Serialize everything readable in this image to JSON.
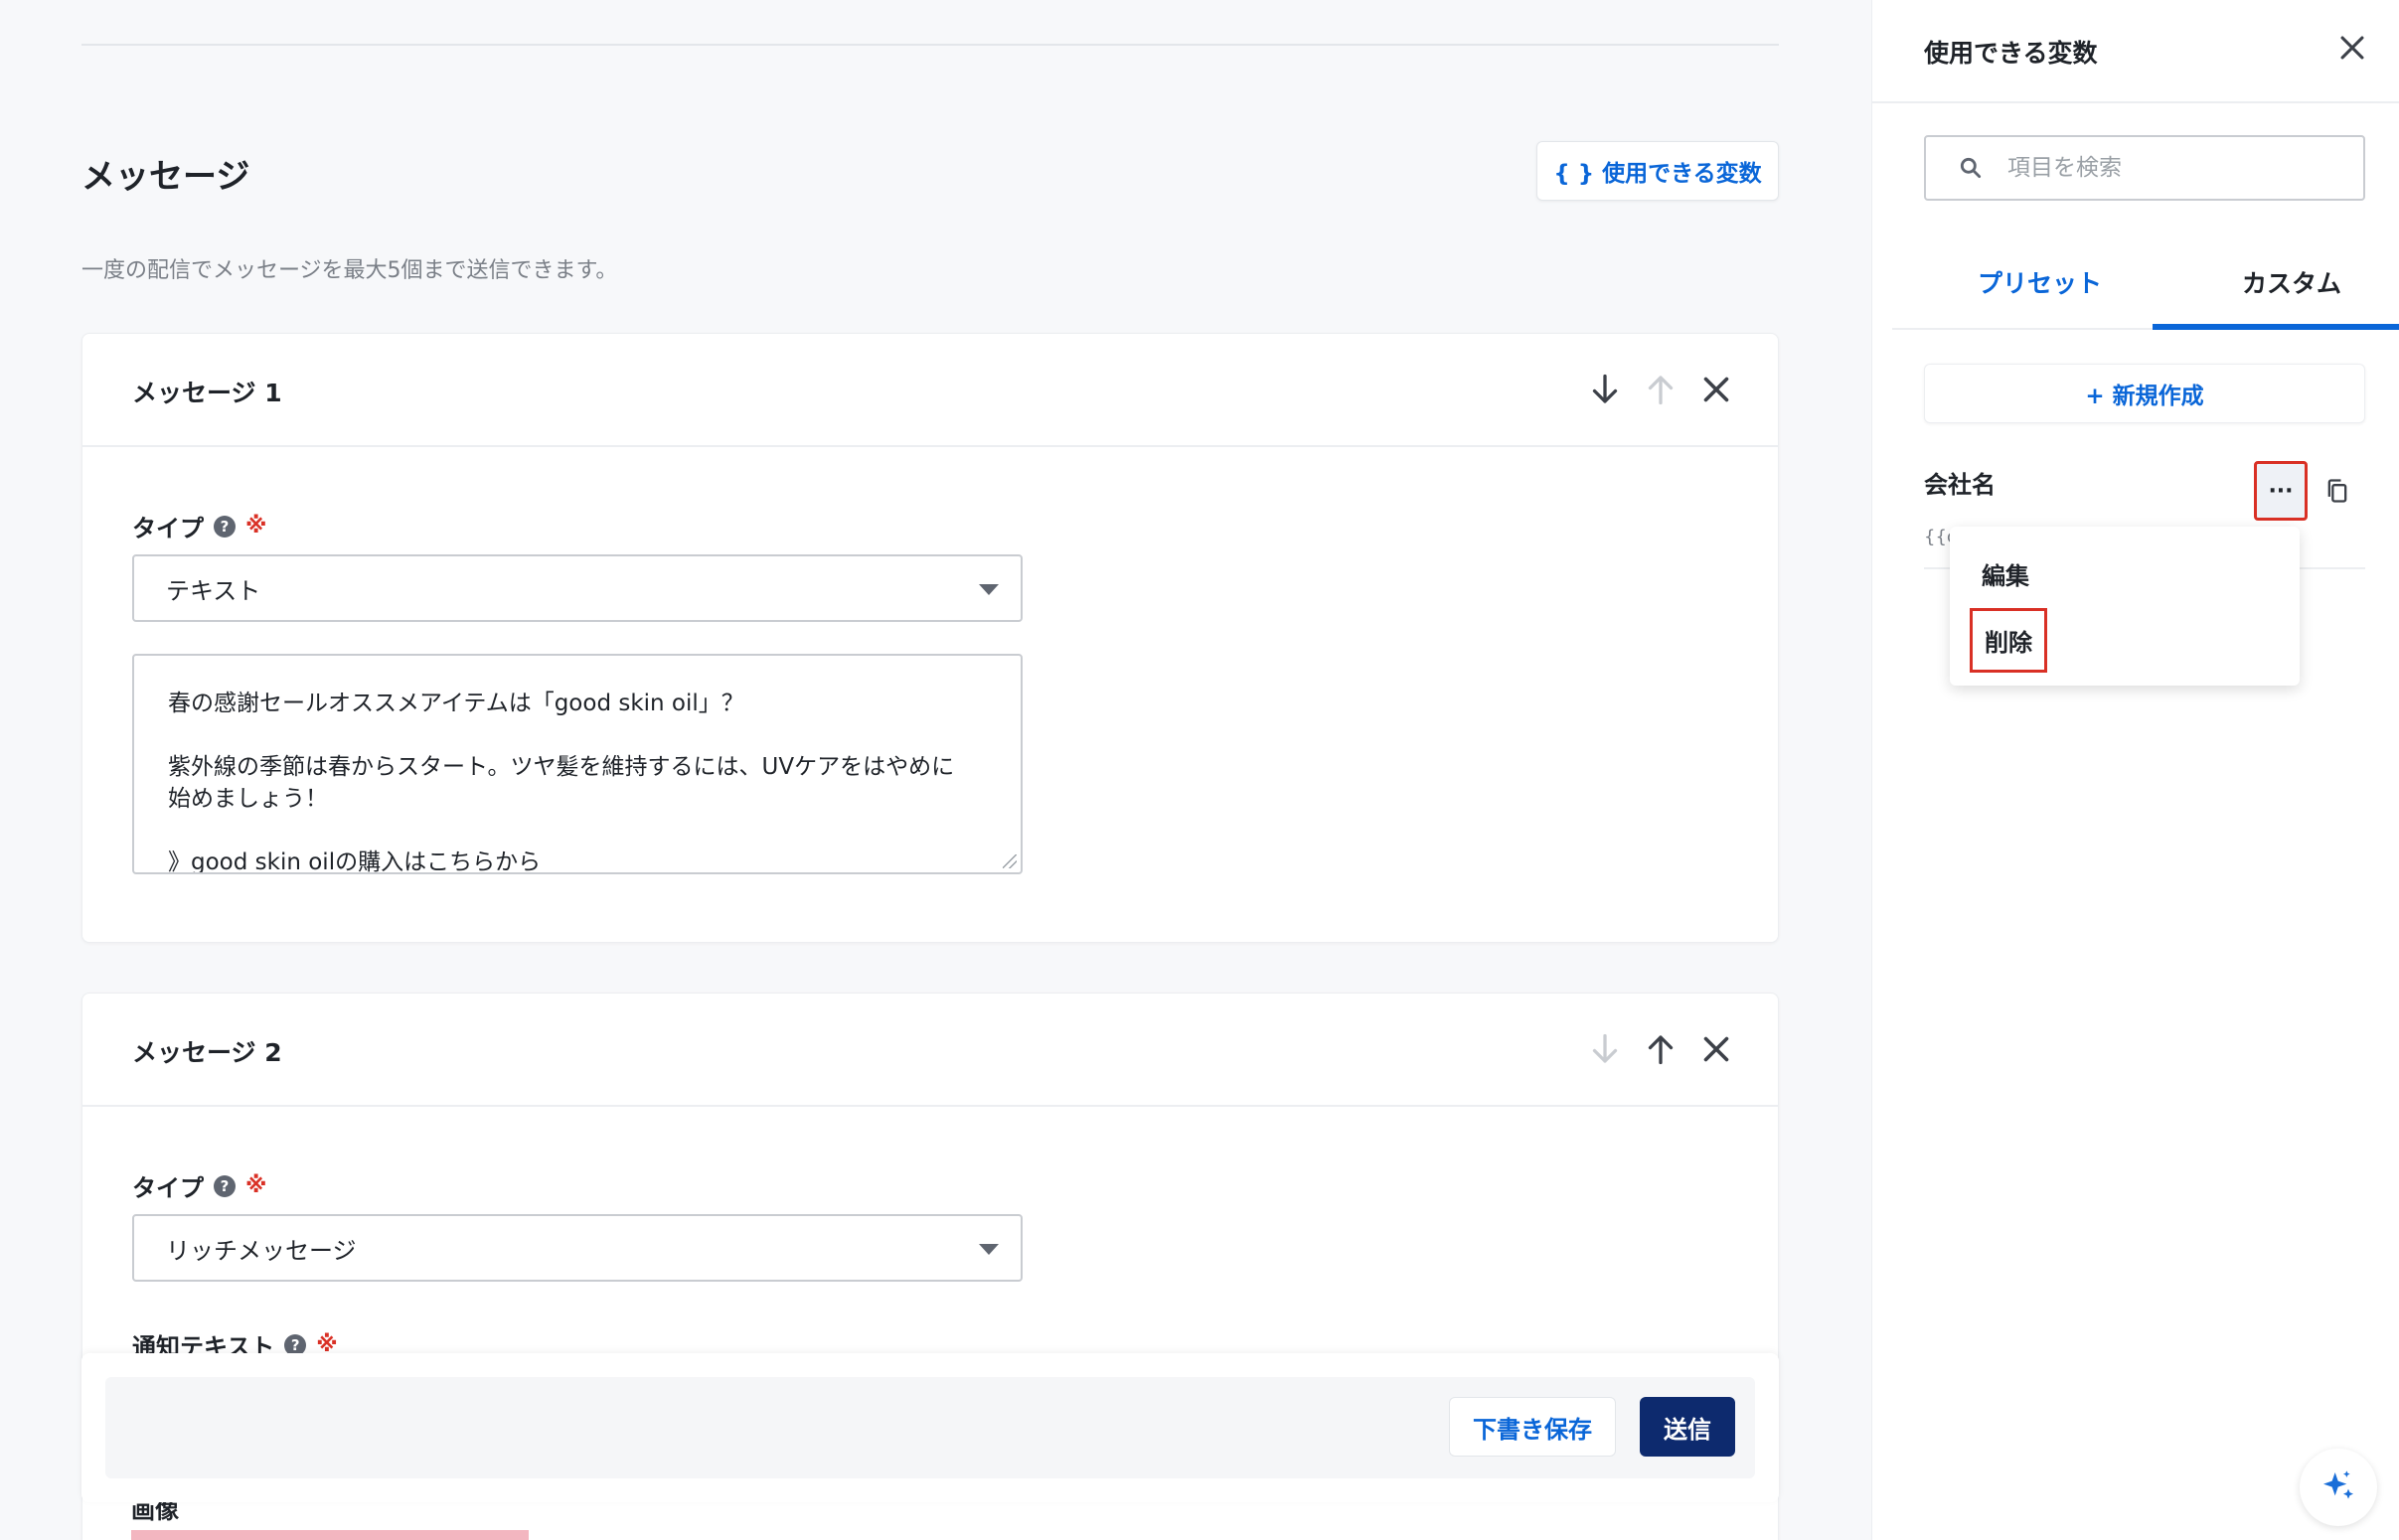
{
  "main": {
    "section_title": "メッセージ",
    "vars_button_label": "{ } 使用できる変数",
    "subtitle": "一度の配信でメッセージを最大5個まで送信できます。"
  },
  "messages": [
    {
      "title": "メッセージ 1",
      "type_label": "タイプ",
      "type_value": "テキスト",
      "body": "春の感謝セールオススメアイテムは「good skin oil」？\n\n紫外線の季節は春からスタート。ツヤ髪を維持するには、UVケアをはやめに\n始めましょう！\n\n》good skin oilの購入はこちらから",
      "move_down_enabled": true,
      "move_up_enabled": false
    },
    {
      "title": "メッセージ 2",
      "type_label": "タイプ",
      "type_value": "リッチメッセージ",
      "notify_label": "通知テキスト",
      "image_label": "画像",
      "move_down_enabled": false,
      "move_up_enabled": true
    }
  ],
  "required_mark": "※",
  "help_mark": "?",
  "footer": {
    "draft_label": "下書き保存",
    "send_label": "送信"
  },
  "panel": {
    "title": "使用できる変数",
    "search_placeholder": "項目を検索",
    "tabs": [
      {
        "label": "プリセット",
        "active": false
      },
      {
        "label": "カスタム",
        "active": true
      }
    ],
    "new_button_label": "+ 新規作成",
    "variable": {
      "name": "会社名",
      "code_visible": "{{cc"
    },
    "more_label": "···",
    "menu": {
      "edit": "編集",
      "delete": "削除"
    }
  },
  "colors": {
    "accent": "#0a66d8",
    "primary_button": "#0d2a6e",
    "highlight": "#d93025"
  },
  "icons": [
    "arrow-down-icon",
    "arrow-up-icon",
    "close-icon",
    "search-icon",
    "copy-icon",
    "sparkle-icon",
    "caret-down-icon",
    "help-icon"
  ]
}
